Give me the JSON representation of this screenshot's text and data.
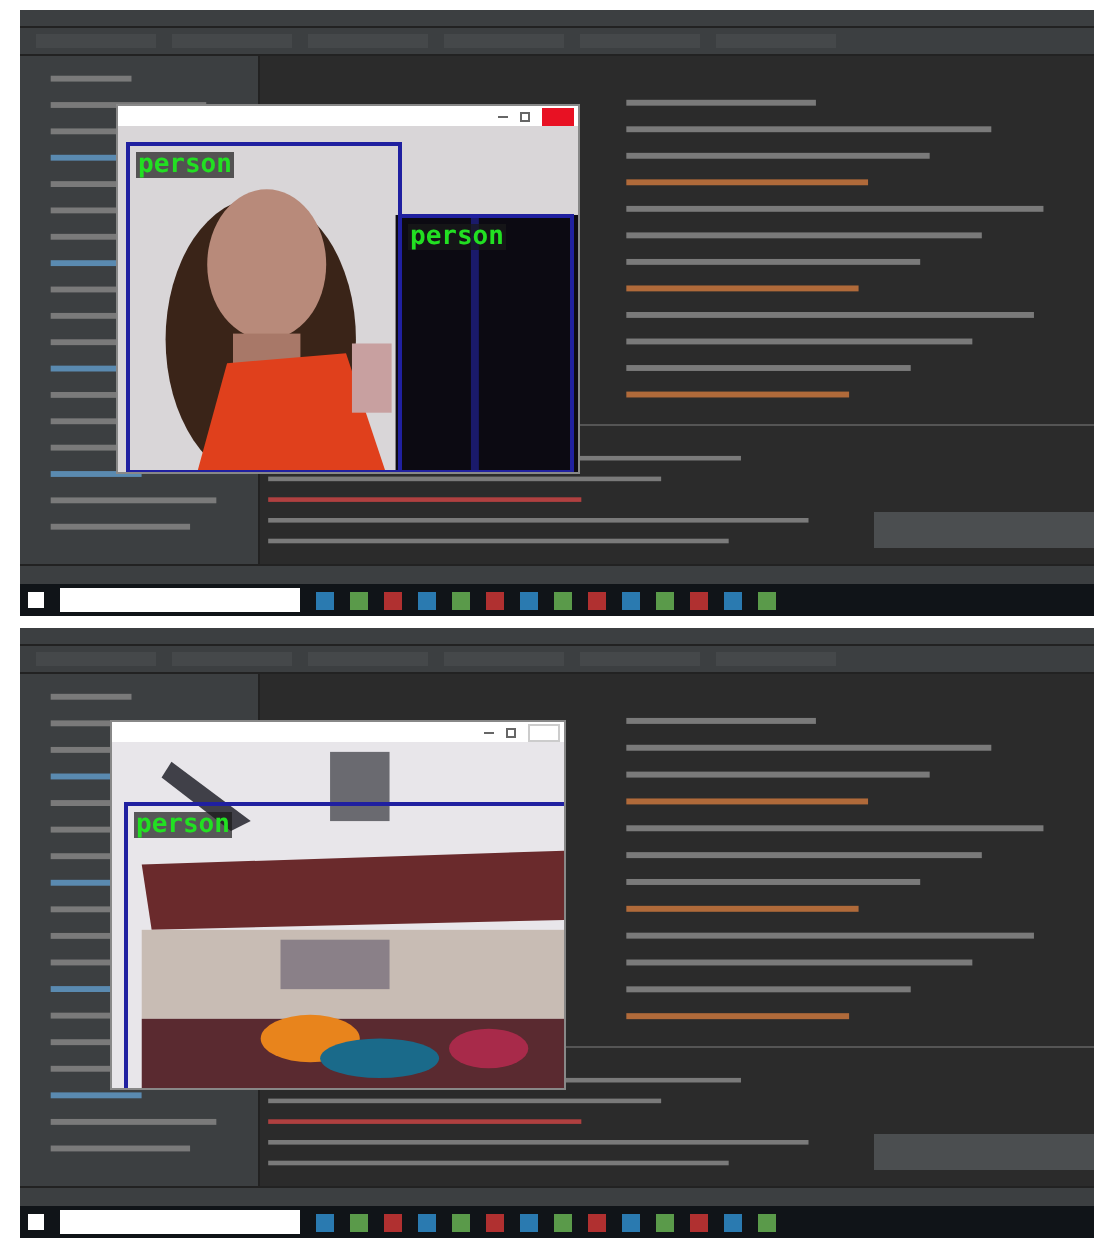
{
  "screenshots": [
    {
      "camera_window": {
        "close_hovered": true,
        "detections": [
          {
            "label": "person"
          },
          {
            "label": "person"
          }
        ]
      }
    },
    {
      "camera_window": {
        "close_hovered": false,
        "detections": [
          {
            "label": "person"
          }
        ]
      }
    }
  ]
}
